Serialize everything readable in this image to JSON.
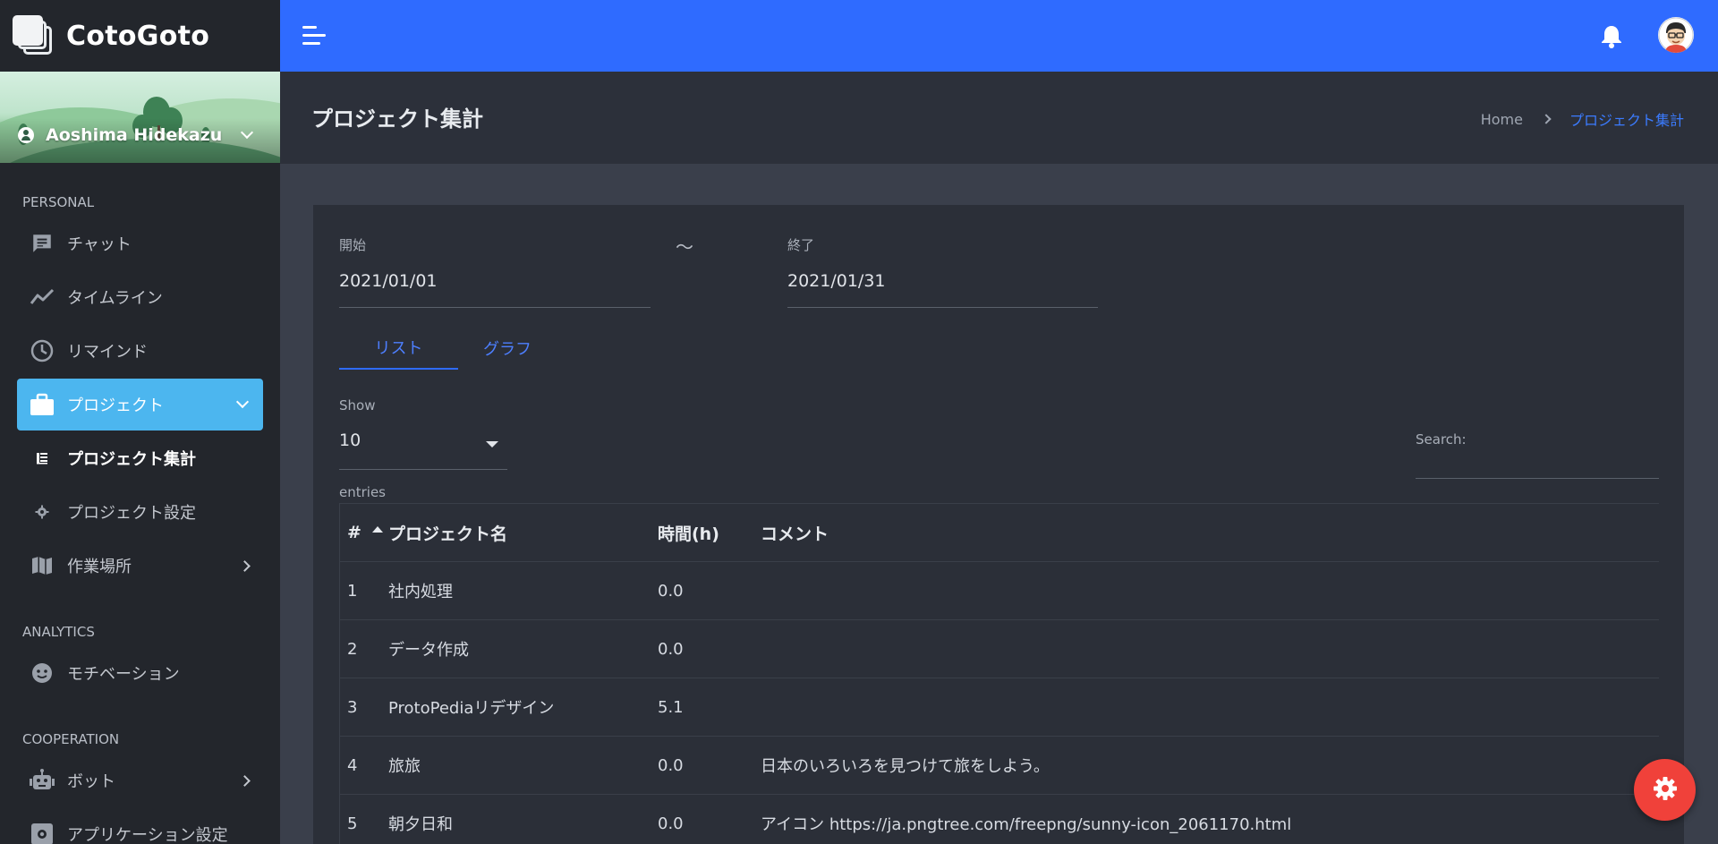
{
  "app": {
    "name": "CotoGoto"
  },
  "user": {
    "name": "Aoshima Hidekazu"
  },
  "sidebar": {
    "sections": [
      "PERSONAL",
      "ANALYTICS",
      "COOPERATION"
    ],
    "items": [
      {
        "label": "チャット"
      },
      {
        "label": "タイムライン"
      },
      {
        "label": "リマインド"
      },
      {
        "label": "プロジェクト"
      },
      {
        "label": "プロジェクト集計"
      },
      {
        "label": "プロジェクト設定"
      },
      {
        "label": "作業場所"
      },
      {
        "label": "モチベーション"
      },
      {
        "label": "ボット"
      },
      {
        "label": "アプリケーション設定"
      }
    ]
  },
  "page": {
    "title": "プロジェクト集計",
    "breadcrumb": {
      "home": "Home",
      "current": "プロジェクト集計"
    }
  },
  "filters": {
    "start_label": "開始",
    "start_value": "2021/01/01",
    "separator": "〜",
    "end_label": "終了",
    "end_value": "2021/01/31"
  },
  "tabs": [
    {
      "label": "リスト",
      "active": true
    },
    {
      "label": "グラフ",
      "active": false
    }
  ],
  "table_controls": {
    "show_label": "Show",
    "show_value": "10",
    "entries_label": "entries",
    "search_label": "Search:"
  },
  "table": {
    "headers": [
      "#",
      "プロジェクト名",
      "時間(h)",
      "コメント"
    ],
    "rows": [
      {
        "num": "1",
        "name": "社内処理",
        "time": "0.0",
        "comment": ""
      },
      {
        "num": "2",
        "name": "データ作成",
        "time": "0.0",
        "comment": ""
      },
      {
        "num": "3",
        "name": "ProtoPediaリデザイン",
        "time": "5.1",
        "comment": ""
      },
      {
        "num": "4",
        "name": "旅旅",
        "time": "0.0",
        "comment": "日本のいろいろを見つけて旅をしよう。"
      },
      {
        "num": "5",
        "name": "朝夕日和",
        "time": "0.0",
        "comment": "アイコン https://ja.pngtree.com/freepng/sunny-icon_2061170.html"
      }
    ]
  },
  "colors": {
    "topbar": "#2f6bff",
    "sidebar": "#23262c",
    "active_nav": "#4cb6ef",
    "fab": "#f0413a",
    "content_bg": "#3a3f4b",
    "card_bg": "#2b2f38"
  }
}
